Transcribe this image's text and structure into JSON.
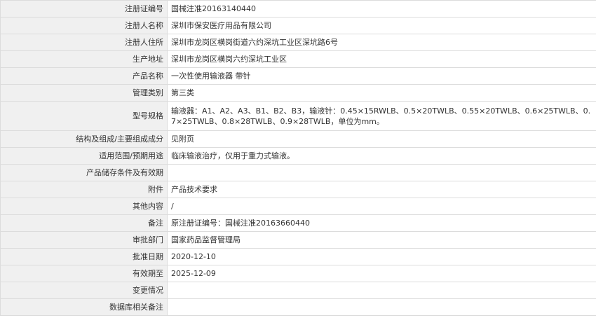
{
  "rows": [
    {
      "label": "注册证编号",
      "value": "国械注准20163140440"
    },
    {
      "label": "注册人名称",
      "value": "深圳市保安医疗用品有限公司"
    },
    {
      "label": "注册人住所",
      "value": "深圳市龙岗区横岗街道六约深坑工业区深坑路6号"
    },
    {
      "label": "生产地址",
      "value": "深圳市龙岗区横岗六约深坑工业区"
    },
    {
      "label": "产品名称",
      "value": "一次性使用输液器 带针"
    },
    {
      "label": "管理类别",
      "value": "第三类"
    },
    {
      "label": "型号规格",
      "value": "输液器：A1、A2、A3、B1、B2、B3，输液针：0.45×15RWLB、0.5×20TWLB、0.55×20TWLB、0.6×25TWLB、0.7×25TWLB、0.8×28TWLB、0.9×28TWLB，单位为mm。"
    },
    {
      "label": "结构及组成/主要组成成分",
      "value": "见附页"
    },
    {
      "label": "适用范围/预期用途",
      "value": "临床输液治疗，仅用于重力式输液。"
    },
    {
      "label": "产品储存条件及有效期",
      "value": ""
    },
    {
      "label": "附件",
      "value": "产品技术要求"
    },
    {
      "label": "其他内容",
      "value": "/"
    },
    {
      "label": "备注",
      "value": "原注册证编号：国械注准20163660440"
    },
    {
      "label": "审批部门",
      "value": "国家药品监督管理局"
    },
    {
      "label": "批准日期",
      "value": "2020-12-10"
    },
    {
      "label": "有效期至",
      "value": "2025-12-09"
    },
    {
      "label": "变更情况",
      "value": ""
    },
    {
      "label": "数据库相关备注",
      "value": ""
    }
  ]
}
